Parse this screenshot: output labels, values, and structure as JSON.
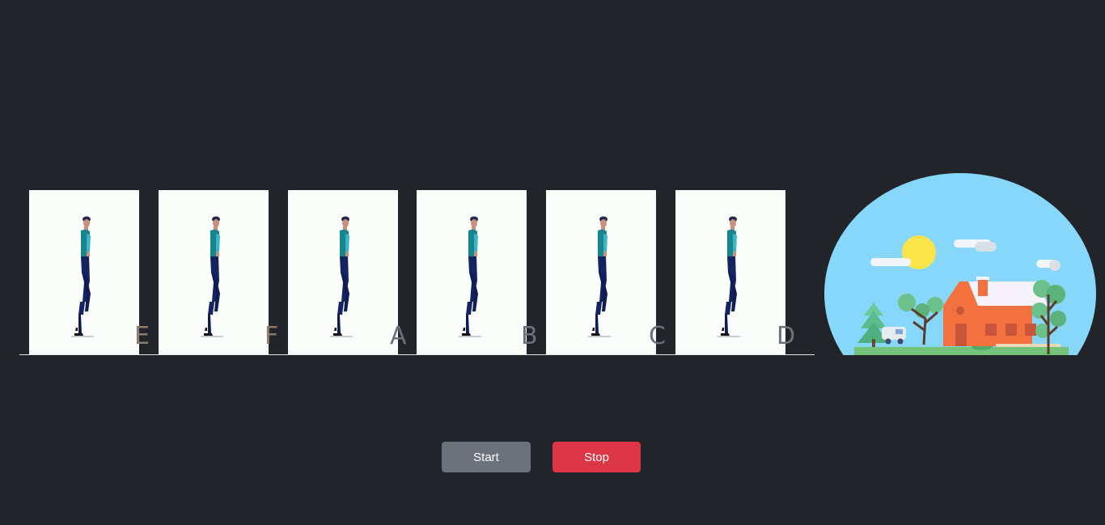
{
  "frames": [
    {
      "letter": "E"
    },
    {
      "letter": "F"
    },
    {
      "letter": "A"
    },
    {
      "letter": "B"
    },
    {
      "letter": "C"
    },
    {
      "letter": "D"
    }
  ],
  "controls": {
    "start_label": "Start",
    "stop_label": "Stop"
  },
  "colors": {
    "background": "#212429",
    "frame": "#fbfdfb",
    "sky": "#87d7fa",
    "sun": "#fbe54b",
    "house": "#f3703f",
    "start_button": "#6c727b",
    "stop_button": "#dc3545"
  }
}
